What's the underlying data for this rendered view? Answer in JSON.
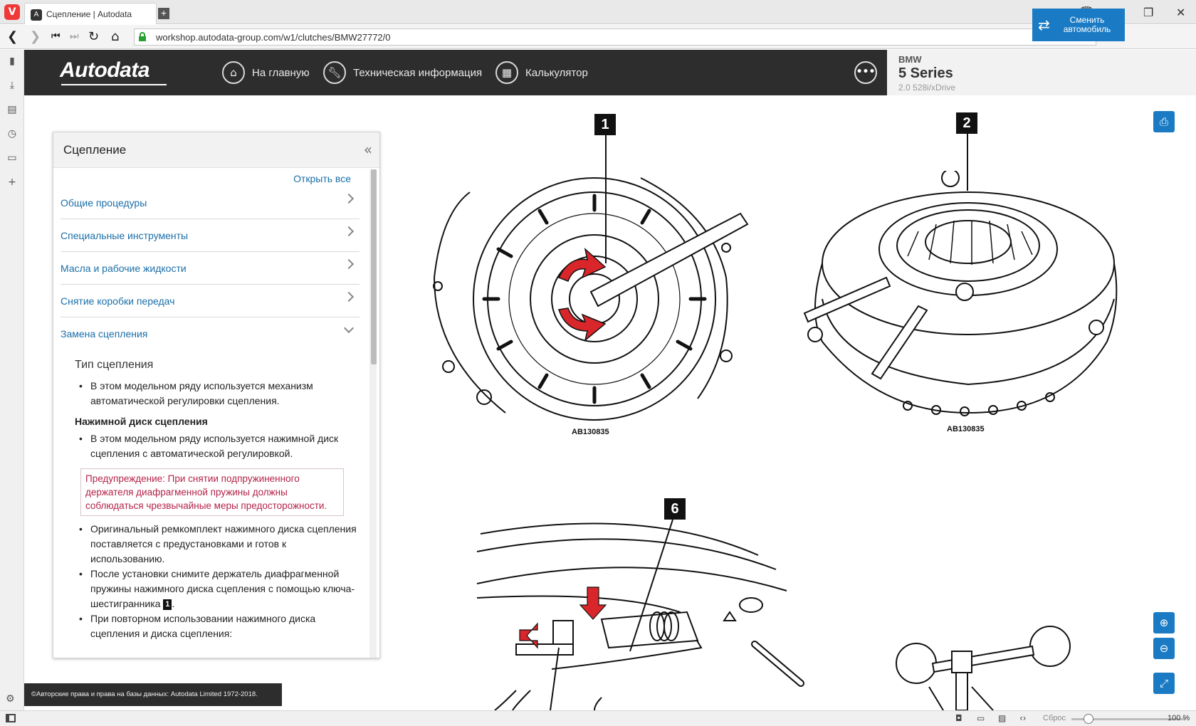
{
  "browser": {
    "tab_title": "Сцепление | Autodata",
    "url": "workshop.autodata-group.com/w1/clutches/BMW27772/0"
  },
  "header": {
    "logo": "Autodata",
    "nav": [
      {
        "label": "На главную",
        "icon": "home-icon"
      },
      {
        "label": "Техническая информация",
        "icon": "wrench-icon"
      },
      {
        "label": "Калькулятор",
        "icon": "calculator-icon"
      }
    ],
    "vehicle": {
      "make": "BMW",
      "model": "5 Series",
      "engine": "2.0 528i/xDrive"
    },
    "change_button": "Сменить автомобиль"
  },
  "panel": {
    "title": "Сцепление",
    "open_all": "Открыть все",
    "items": [
      {
        "label": "Общие процедуры",
        "expanded": false
      },
      {
        "label": "Специальные инструменты",
        "expanded": false
      },
      {
        "label": "Масла и рабочие жидкости",
        "expanded": false
      },
      {
        "label": "Снятие коробки передач",
        "expanded": false
      },
      {
        "label": "Замена сцепления",
        "expanded": true
      }
    ],
    "content": {
      "subtitle": "Тип сцепления",
      "bullet1": "В этом модельном ряду используется механизм автоматической регулировки сцепления.",
      "subheading": "Нажимной диск сцепления",
      "bullet2": "В этом модельном ряду используется нажимной диск сцепления с автоматической регулировкой.",
      "warning": "Предупреждение: При снятии подпружиненного держателя диафрагменной пружины должны соблюдаться чрезвычайные меры предосторожности.",
      "bullet3": "Оригинальный ремкомплект нажимного диска сцепления поставляется с предустановками и готов к использованию.",
      "bullet4_pre": "После установки снимите держатель диафрагменной пружины нажимного диска сцепления с помощью ключа-шестигранника",
      "bullet4_badge": "1",
      "bullet4_post": ".",
      "bullet5": "При повторном использовании нажимного диска сцепления и диска сцепления:"
    }
  },
  "figures": [
    {
      "callout": "1",
      "label": "AB130835"
    },
    {
      "callout": "2",
      "label": "AB130835"
    },
    {
      "callout": "6",
      "label": ""
    }
  ],
  "copyright": "©Авторские права и права на базы данных: Autodata Limited 1972-2018.",
  "statusbar": {
    "reset": "Сброс",
    "zoom": "100 %"
  },
  "colors": {
    "accent": "#1a7bc4",
    "header_bg": "#2d2d2d",
    "link": "#1a6fa8",
    "warning": "#b3234a",
    "arrow": "#d9262b"
  }
}
